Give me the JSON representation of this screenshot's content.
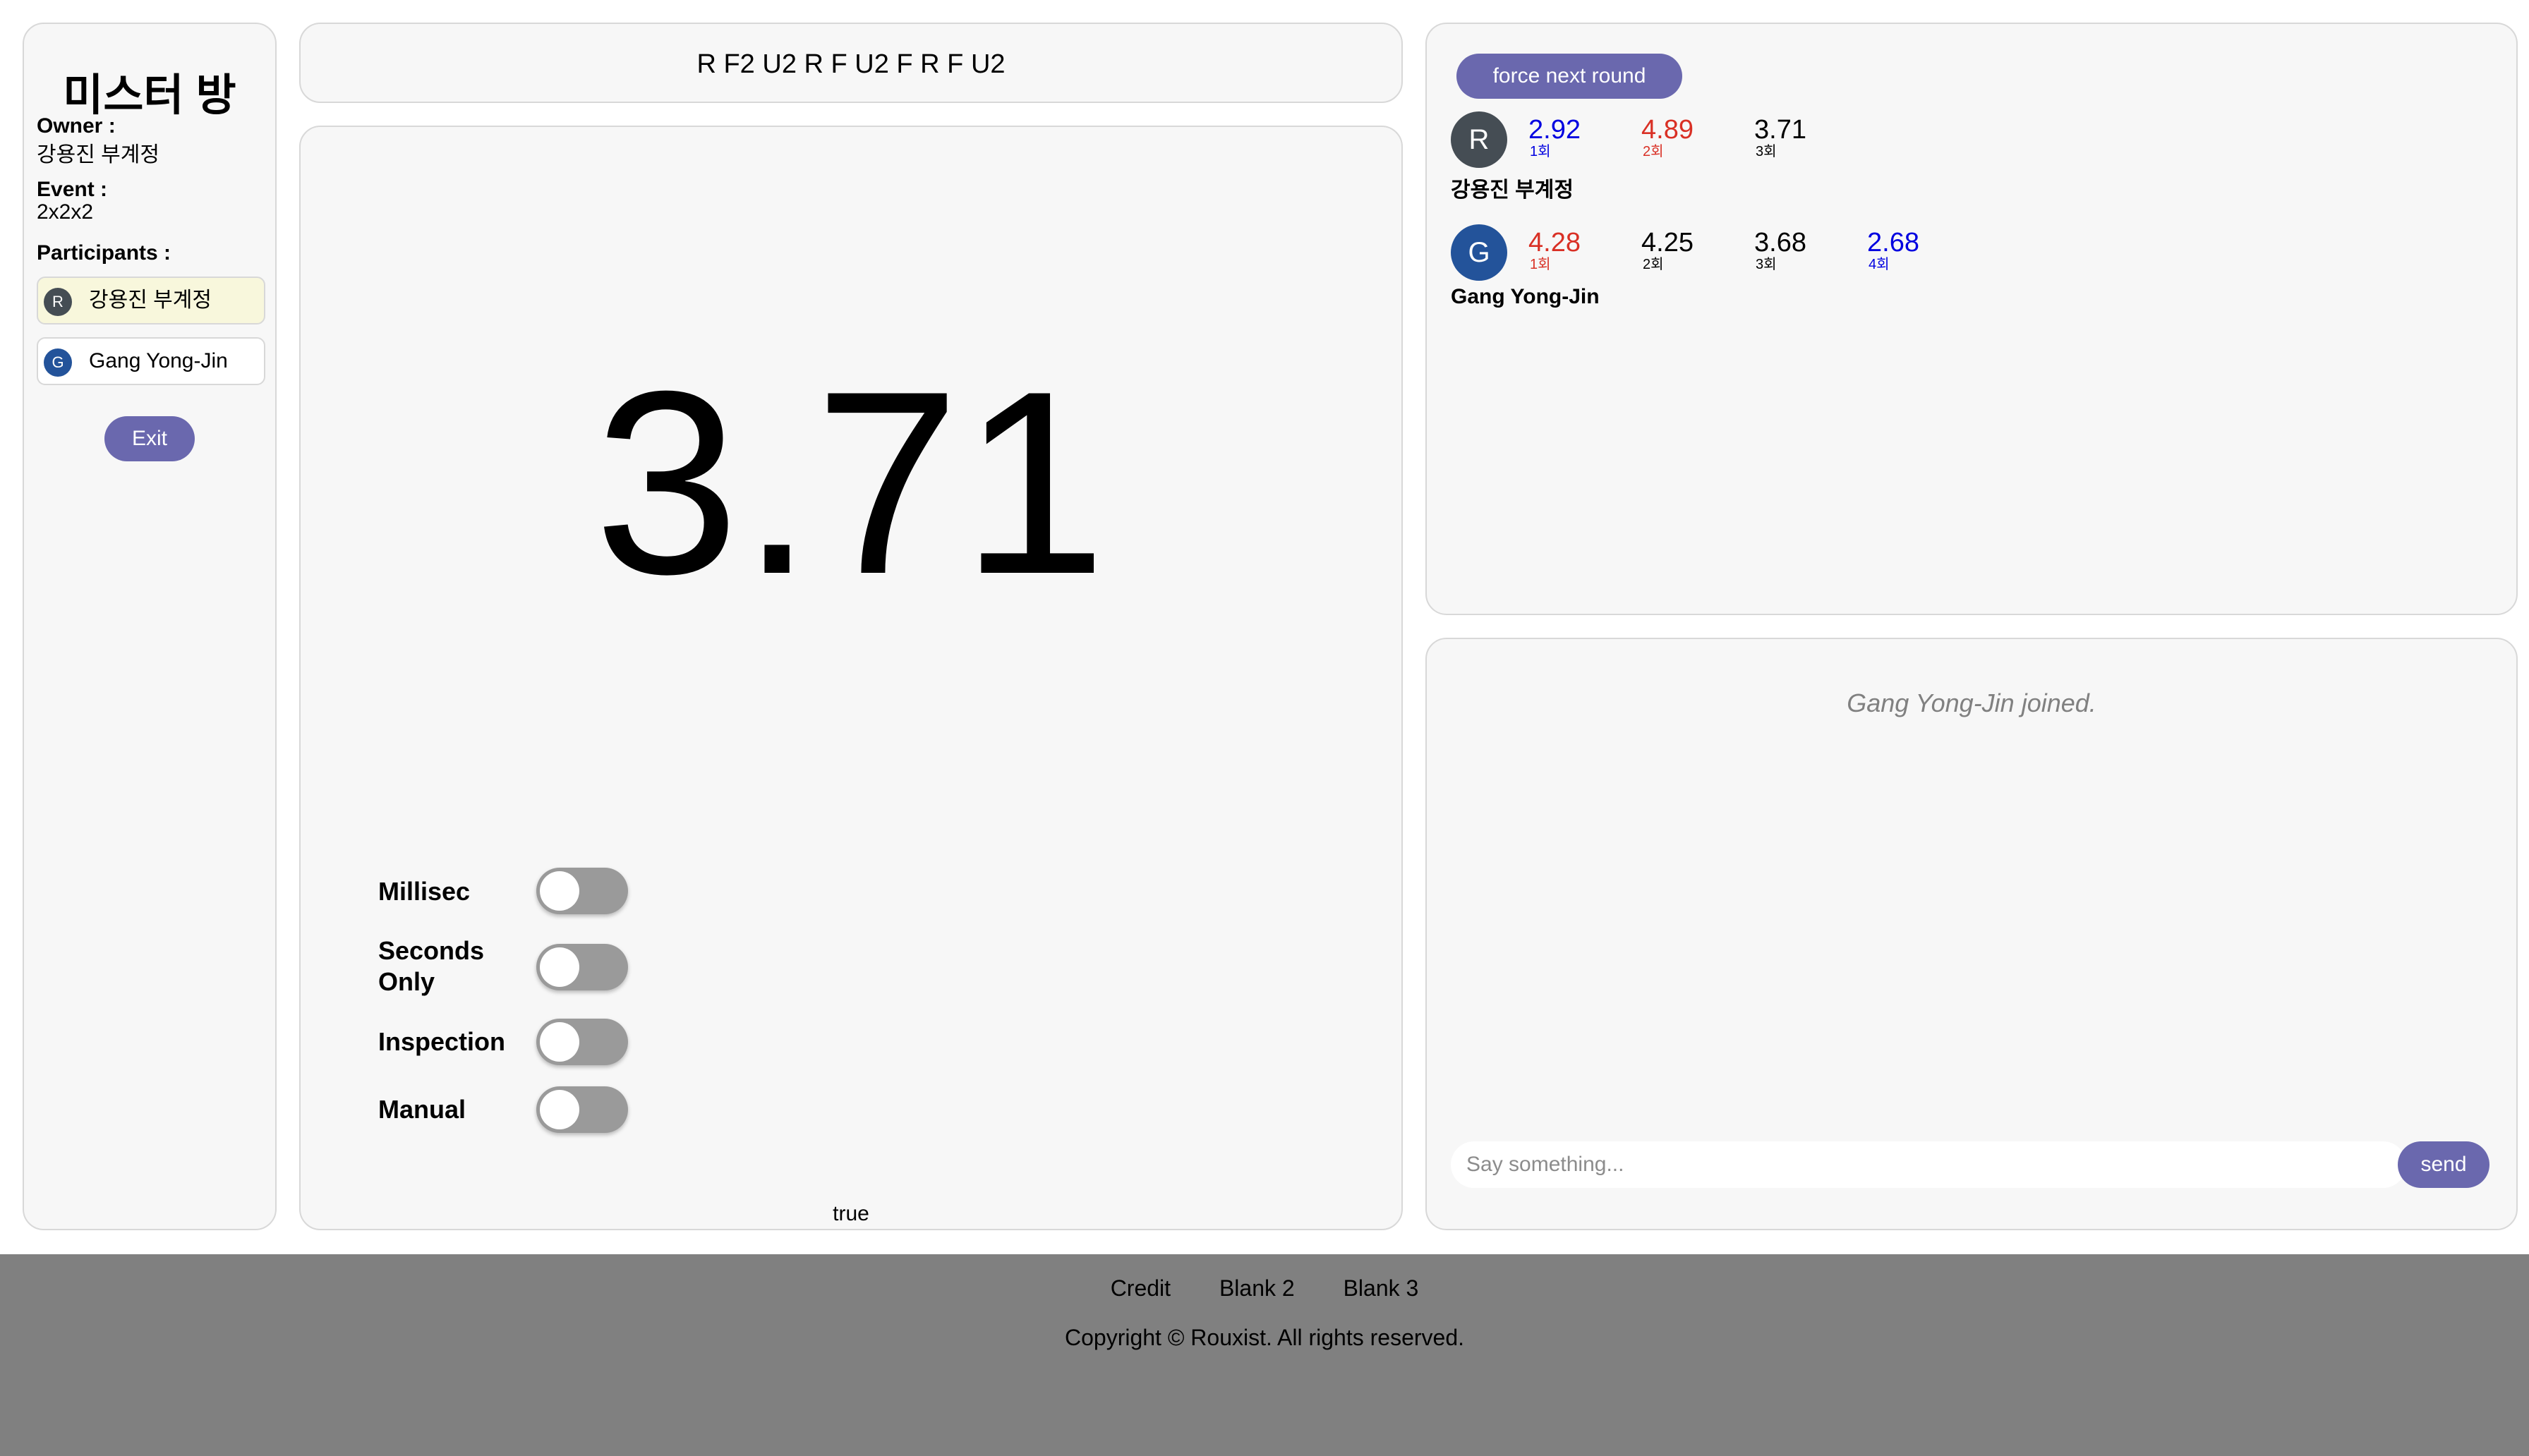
{
  "room": {
    "title": "미스터 방",
    "owner_label": "Owner :",
    "owner": "강용진 부계정",
    "event_label": "Event :",
    "event": "2x2x2",
    "participants_label": "Participants :",
    "participants": [
      {
        "initial": "R",
        "name": "강용진 부계정",
        "avatar_color": "#454d54"
      },
      {
        "initial": "G",
        "name": "Gang Yong-Jin",
        "avatar_color": "#23539a"
      }
    ],
    "exit_label": "Exit"
  },
  "scramble": "R F2 U2 R F U2 F R F U2",
  "timer": {
    "value": "3.71",
    "options": [
      {
        "label": "Millisec",
        "on": false
      },
      {
        "label": "Seconds\nOnly",
        "on": false
      },
      {
        "label": "Inspection",
        "on": false
      },
      {
        "label": "Manual",
        "on": false
      }
    ],
    "status": "true"
  },
  "results": {
    "force_label": "force next round",
    "users": [
      {
        "initial": "R",
        "name": "강용진 부계정",
        "avatar_color": "#454d54",
        "solves": [
          {
            "time": "2.92",
            "round": "1회",
            "color": "#0000e0"
          },
          {
            "time": "4.89",
            "round": "2회",
            "color": "#d93025"
          },
          {
            "time": "3.71",
            "round": "3회",
            "color": "#000000"
          }
        ]
      },
      {
        "initial": "G",
        "name": "Gang Yong-Jin",
        "avatar_color": "#23539a",
        "solves": [
          {
            "time": "4.28",
            "round": "1회",
            "color": "#d93025"
          },
          {
            "time": "4.25",
            "round": "2회",
            "color": "#000000"
          },
          {
            "time": "3.68",
            "round": "3회",
            "color": "#000000"
          },
          {
            "time": "2.68",
            "round": "4회",
            "color": "#0000e0"
          }
        ]
      }
    ]
  },
  "chat": {
    "messages": [
      "Gang Yong-Jin joined."
    ],
    "placeholder": "Say something...",
    "send_label": "send"
  },
  "footer": {
    "links": [
      "Credit",
      "Blank 2",
      "Blank 3"
    ],
    "copyright": "Copyright © Rouxist. All rights reserved."
  },
  "colors": {
    "accent": "#6a68ae",
    "panel_bg": "#f7f7f7",
    "panel_border": "#d8d8d8",
    "footer_bg": "#808080",
    "best_time": "#0000e0",
    "worst_time": "#d93025"
  }
}
